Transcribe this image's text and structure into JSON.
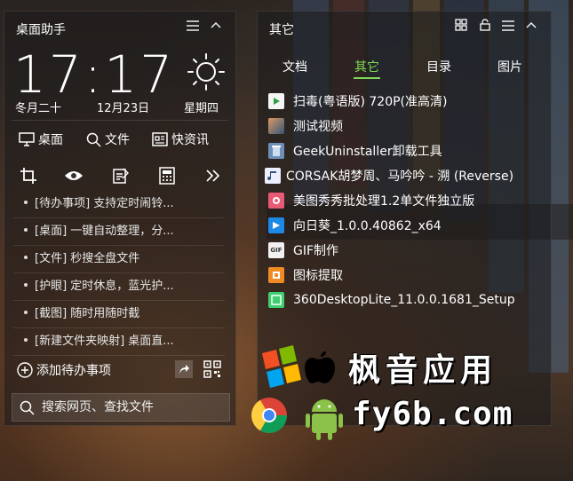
{
  "left_panel": {
    "title": "桌面助手",
    "clock": "17:17",
    "lunar_date": "冬月二十",
    "date": "12月23日",
    "weekday": "星期四",
    "tools": [
      "桌面",
      "文件",
      "快资讯"
    ],
    "tips": [
      "[待办事项] 支持定时闹铃...",
      "[桌面] 一键自动整理，分...",
      "[文件] 秒搜全盘文件",
      "[护眼] 定时休息，蓝光护...",
      "[截图] 随时用随时截",
      "[新建文件夹映射] 桌面直..."
    ],
    "add_todo": "添加待办事项",
    "search_placeholder": "搜索网页、查找文件"
  },
  "right_panel": {
    "title": "其它",
    "tabs": [
      "文档",
      "其它",
      "目录",
      "图片"
    ],
    "active_tab": 1,
    "accent": "#7ed957",
    "files": [
      {
        "name": "扫毒(粤语版) 720P(准高清)",
        "icon": "video-file-icon"
      },
      {
        "name": "测试视频",
        "icon": "video-thumbnail-icon"
      },
      {
        "name": "GeekUninstaller卸载工具",
        "icon": "uninstaller-icon"
      },
      {
        "name": "CORSAK胡梦周、马吟吟 - 溯 (Reverse)",
        "icon": "audio-file-icon"
      },
      {
        "name": "美图秀秀批处理1.2单文件独立版",
        "icon": "meitu-icon"
      },
      {
        "name": "向日葵_1.0.0.40862_x64",
        "icon": "sunlogin-icon"
      },
      {
        "name": "GIF制作",
        "icon": "gif-icon"
      },
      {
        "name": "图标提取",
        "icon": "icon-extract-icon"
      },
      {
        "name": "360DesktopLite_11.0.0.1681_Setup",
        "icon": "installer-icon"
      }
    ]
  },
  "watermark": {
    "cn": "枫音应用",
    "url": "fy6b.com"
  }
}
